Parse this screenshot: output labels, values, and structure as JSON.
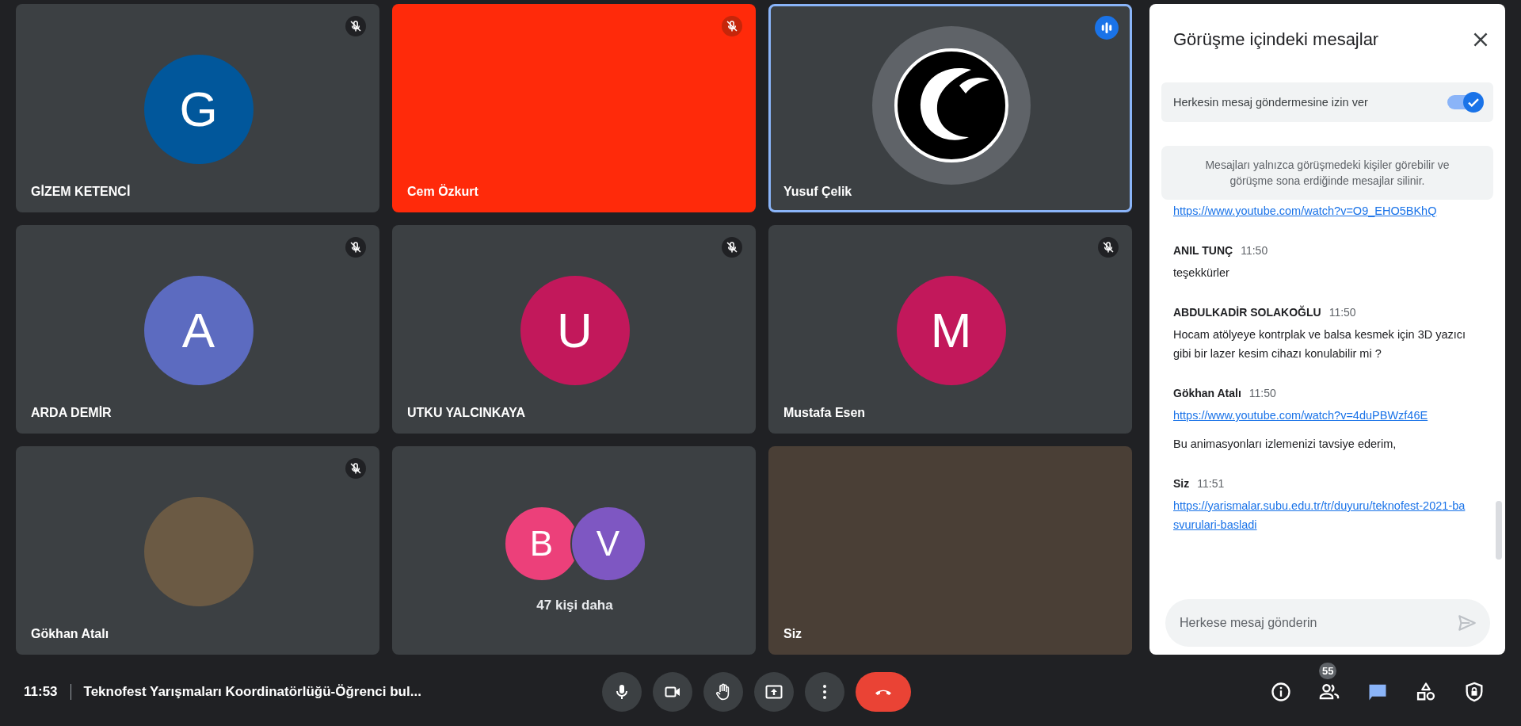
{
  "tiles": [
    {
      "kind": "avatar",
      "name": "GİZEM KETENCİ",
      "initial": "G",
      "color": "#01579b",
      "muted": true,
      "speaking": false
    },
    {
      "kind": "color-block",
      "name": "Cem Özkurt",
      "color": "#ff2a0a",
      "muted": true,
      "speaking": false
    },
    {
      "kind": "logo",
      "name": "Yusuf Çelik",
      "muted": false,
      "speaking": true
    },
    {
      "kind": "avatar",
      "name": "ARDA DEMİR",
      "initial": "A",
      "color": "#5c6bc0",
      "muted": true,
      "speaking": false
    },
    {
      "kind": "avatar",
      "name": "UTKU YALCINKAYA",
      "initial": "U",
      "color": "#c2185b",
      "muted": true,
      "speaking": false
    },
    {
      "kind": "avatar",
      "name": "Mustafa Esen",
      "initial": "M",
      "color": "#c2185b",
      "muted": true,
      "speaking": false
    },
    {
      "kind": "photo",
      "name": "Gökhan Atalı",
      "muted": true,
      "speaking": false
    },
    {
      "kind": "others",
      "label": "47 kişi daha",
      "avatars": [
        {
          "initial": "B",
          "color": "#ec407a"
        },
        {
          "initial": "V",
          "color": "#7e57c2"
        }
      ],
      "muted": false,
      "speaking": false
    },
    {
      "kind": "video",
      "name": "Siz",
      "muted": false,
      "speaking": false
    }
  ],
  "chat": {
    "title": "Görüşme içindeki mesajlar",
    "toggle": {
      "label": "Herkesin mesaj göndermesine izin ver",
      "on": true
    },
    "notice": "Mesajları yalnızca görüşmedeki kişiler görebilir ve görüşme sona erdiğinde mesajlar silinir.",
    "messages": [
      {
        "parts": [
          {
            "kind": "link",
            "text": "https://www.youtube.com/watch?v=O9_EHO5BKhQ"
          }
        ]
      },
      {
        "sender": "ANIL TUNÇ",
        "time": "11:50",
        "parts": [
          {
            "kind": "text",
            "text": "teşekkürler"
          }
        ]
      },
      {
        "sender": "ABDULKADİR SOLAKOĞLU",
        "time": "11:50",
        "parts": [
          {
            "kind": "text",
            "text": "Hocam atölyeye kontrplak ve balsa kesmek için 3D yazıcı gibi bir lazer kesim cihazı konulabilir mi ?"
          }
        ]
      },
      {
        "sender": "Gökhan Atalı",
        "time": "11:50",
        "parts": [
          {
            "kind": "link",
            "text": "https://www.youtube.com/watch?v=4duPBWzf46E"
          },
          {
            "kind": "text",
            "text": "Bu animasyonları izlemenizi tavsiye ederim,"
          }
        ]
      },
      {
        "sender": "Siz",
        "time": "11:51",
        "parts": [
          {
            "kind": "link",
            "text": "https://yarismalar.subu.edu.tr/tr/duyuru/teknofest-2021-basvurulari-basladi"
          }
        ]
      }
    ],
    "input": {
      "placeholder": "Herkese mesaj gönderin"
    }
  },
  "bottom_bar": {
    "time": "11:53",
    "meeting_title": "Teknofest Yarışmaları Koordinatörlüğü-Öğrenci bul...",
    "controls": [
      {
        "kind": "mic"
      },
      {
        "kind": "camera"
      },
      {
        "kind": "hand"
      },
      {
        "kind": "present"
      },
      {
        "kind": "more"
      },
      {
        "kind": "hangup"
      }
    ],
    "side": [
      {
        "kind": "info",
        "selected": false
      },
      {
        "kind": "people",
        "badge": "55",
        "selected": false
      },
      {
        "kind": "chat",
        "selected": true
      },
      {
        "kind": "activities",
        "selected": false
      },
      {
        "kind": "safety",
        "selected": false
      }
    ]
  }
}
